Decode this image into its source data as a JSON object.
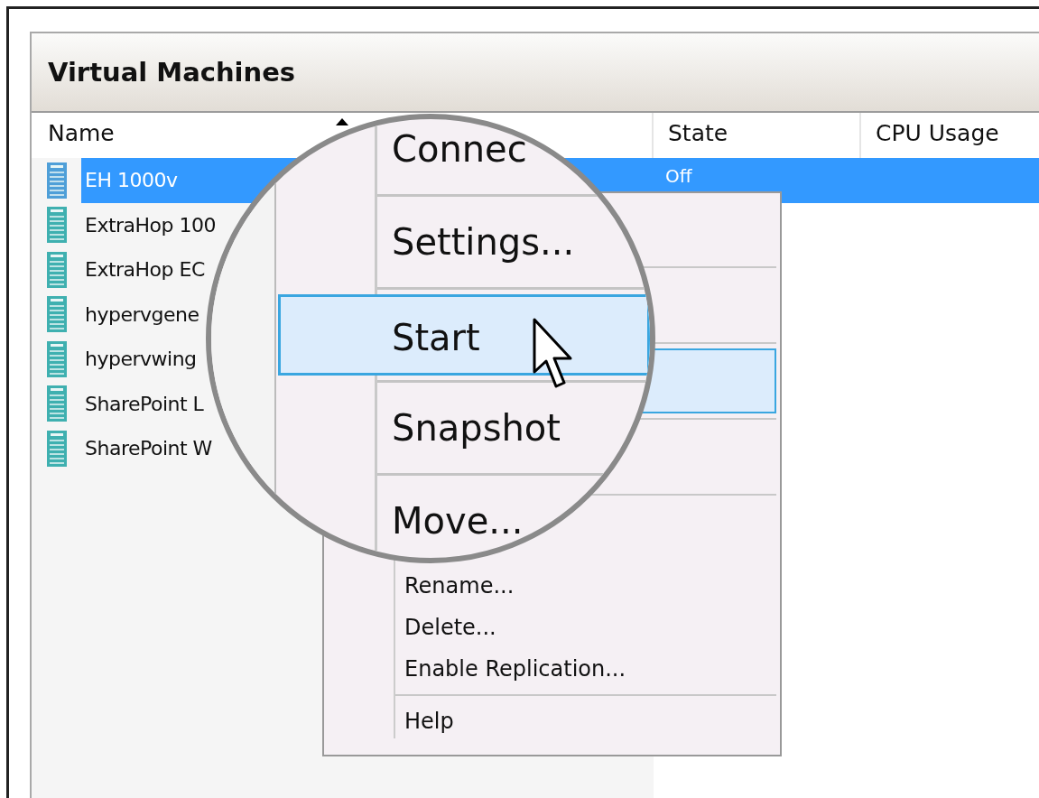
{
  "panel": {
    "title": "Virtual Machines"
  },
  "table": {
    "columns": [
      {
        "label": "Name",
        "sorted": true
      },
      {
        "label": "State",
        "sorted": false
      },
      {
        "label": "CPU Usage",
        "sorted": false
      }
    ],
    "rows": [
      {
        "name": "EH 1000v",
        "state": "Off",
        "selected": true
      },
      {
        "name": "ExtraHop 100",
        "state": "",
        "selected": false
      },
      {
        "name": "ExtraHop EC",
        "state": "",
        "selected": false
      },
      {
        "name": "hypervgene",
        "state": "",
        "selected": false
      },
      {
        "name": "hypervwing",
        "state": "",
        "selected": false
      },
      {
        "name": "SharePoint L",
        "state": "",
        "selected": false
      },
      {
        "name": "SharePoint W",
        "state": "",
        "selected": false
      }
    ]
  },
  "magnifier": {
    "items": [
      {
        "kind": "item",
        "label": "Connec",
        "selected": false
      },
      {
        "kind": "separator"
      },
      {
        "kind": "item",
        "label": "Settings...",
        "selected": false
      },
      {
        "kind": "separator"
      },
      {
        "kind": "item",
        "label": "Start",
        "selected": true
      },
      {
        "kind": "separator"
      },
      {
        "kind": "item",
        "label": "Snapshot",
        "selected": false
      },
      {
        "kind": "separator"
      },
      {
        "kind": "item",
        "label": "Move...",
        "selected": false
      }
    ]
  },
  "context_menu": {
    "items": [
      {
        "kind": "item",
        "label": "Rename...",
        "selected": false
      },
      {
        "kind": "item",
        "label": "Delete...",
        "selected": false
      },
      {
        "kind": "item",
        "label": "Enable Replication...",
        "selected": false
      },
      {
        "kind": "separator"
      },
      {
        "kind": "item",
        "label": "Help",
        "selected": false
      }
    ]
  }
}
